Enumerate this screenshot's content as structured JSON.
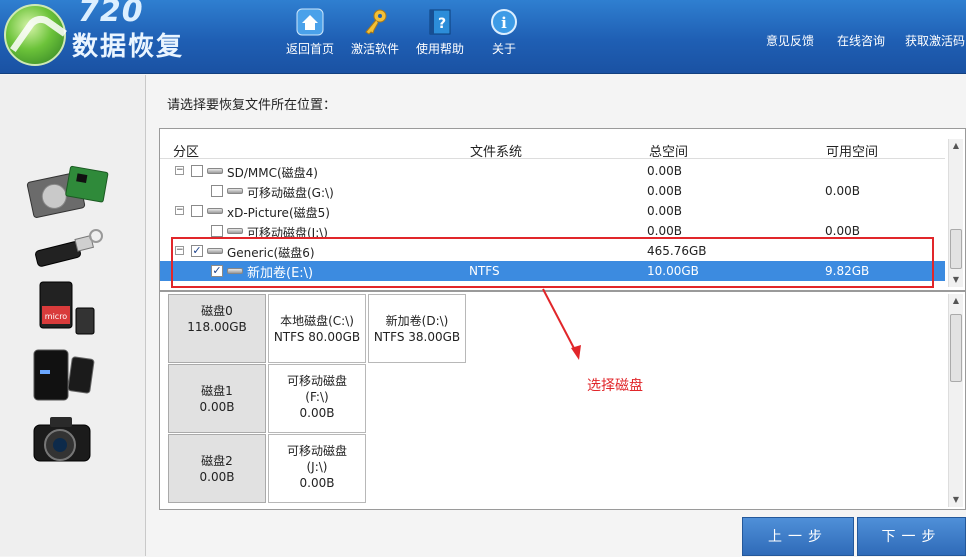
{
  "app": {
    "logo_number": "720",
    "logo_text": "数据恢复"
  },
  "nav": [
    {
      "label": "返回首页",
      "icon": "home-icon"
    },
    {
      "label": "激活软件",
      "icon": "key-icon"
    },
    {
      "label": "使用帮助",
      "icon": "help-book-icon"
    },
    {
      "label": "关于",
      "icon": "info-icon"
    }
  ],
  "links": {
    "feedback": "意见反馈",
    "consult": "在线咨询",
    "activation_code": "获取激活码"
  },
  "sidebar": {
    "devices": [
      {
        "icon": "hard-drive-icon"
      },
      {
        "icon": "usb-drive-icon"
      },
      {
        "icon": "memory-card-icon"
      },
      {
        "icon": "mobile-phone-icon"
      },
      {
        "icon": "camera-icon"
      }
    ]
  },
  "main": {
    "prompt": "请选择要恢复文件所在位置：",
    "columns": {
      "partition": "分区",
      "filesystem": "文件系统",
      "total": "总空间",
      "free": "可用空间"
    },
    "rows": [
      {
        "name": "SD/MMC(磁盘4)",
        "fs": "",
        "total": "0.00B",
        "free": "",
        "level": 0
      },
      {
        "name": "可移动磁盘(G:\\)",
        "fs": "",
        "total": "0.00B",
        "free": "0.00B",
        "level": 1
      },
      {
        "name": "xD-Picture(磁盘5)",
        "fs": "",
        "total": "0.00B",
        "free": "",
        "level": 0
      },
      {
        "name": "可移动磁盘(I:\\)",
        "fs": "",
        "total": "0.00B",
        "free": "0.00B",
        "level": 1
      },
      {
        "name": "Generic(磁盘6)",
        "fs": "",
        "total": "465.76GB",
        "free": "",
        "level": 0,
        "checked": true
      },
      {
        "name": "新加卷(E:\\)",
        "fs": "NTFS",
        "total": "10.00GB",
        "free": "9.82GB",
        "level": 1,
        "checked": true,
        "selected": true
      }
    ],
    "disk_map": [
      {
        "disk": {
          "name": "磁盘0",
          "size": "118.00GB"
        },
        "partitions": [
          {
            "line1": "本地磁盘(C:\\)",
            "line2": "NTFS  80.00GB"
          },
          {
            "line1": "新加卷(D:\\)",
            "line2": "NTFS  38.00GB"
          }
        ]
      },
      {
        "disk": {
          "name": "磁盘1",
          "size": "0.00B"
        },
        "partitions": [
          {
            "line1": "可移动磁盘",
            "line2": "(F:\\)",
            "line3": "0.00B"
          }
        ]
      },
      {
        "disk": {
          "name": "磁盘2",
          "size": "0.00B"
        },
        "partitions": [
          {
            "line1": "可移动磁盘",
            "line2": "(J:\\)",
            "line3": "0.00B"
          }
        ]
      }
    ],
    "annotation": "选择磁盘"
  },
  "buttons": {
    "prev": "上一步",
    "next": "下一步"
  },
  "colors": {
    "header_blue": "#1f5fb4",
    "selection_blue": "#3c8be0",
    "annotation_red": "#e1262a"
  }
}
